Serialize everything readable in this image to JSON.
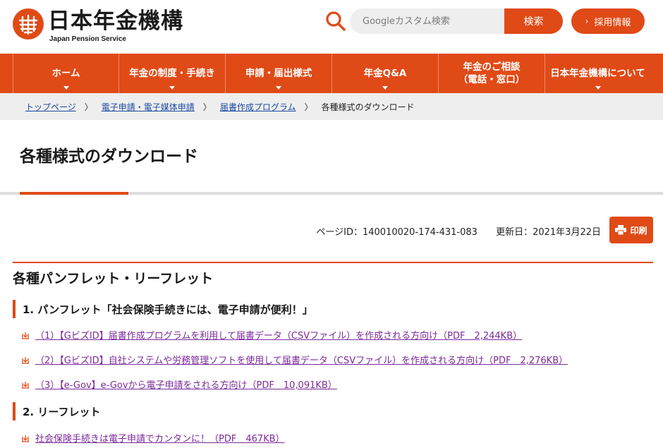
{
  "header": {
    "logo_title": "日本年金機構",
    "logo_subtitle": "Japan Pension Service",
    "search_placeholder": "Googleカスタム検索",
    "search_button": "検索",
    "recruit_button": "採用情報"
  },
  "nav": {
    "items": [
      {
        "label": "ホーム",
        "label2": ""
      },
      {
        "label": "年金の制度・手続き",
        "label2": ""
      },
      {
        "label": "申請・届出様式",
        "label2": ""
      },
      {
        "label": "年金Q&A",
        "label2": ""
      },
      {
        "label": "年金のご相談",
        "label2": "（電話・窓口）"
      },
      {
        "label": "日本年金機構について",
        "label2": ""
      }
    ]
  },
  "breadcrumb": {
    "items": [
      "トップページ",
      "電子申請・電子媒体申請",
      "届書作成プログラム"
    ],
    "current": "各種様式のダウンロード",
    "separator": "〉"
  },
  "page": {
    "title": "各種様式のダウンロード",
    "page_id": "ページID：140010020-174-431-083",
    "updated": "更新日：2021年3月22日",
    "print_label": "印刷"
  },
  "section": {
    "title": "各種パンフレット・リーフレット",
    "groups": [
      {
        "heading": "1.  パンフレット「社会保険手続きには、電子申請が便利！」",
        "links": [
          "（1）【GビズID】届書作成プログラムを利用して届書データ（CSVファイル）を作成される方向け（PDF　2,244KB）",
          "（2）【GビズID】自社システムや労務管理ソフトを使用して届書データ（CSVファイル）を作成される方向け（PDF　2,276KB）",
          "（3）【e-Gov】e-Govから電子申請をされる方向け（PDF　10,091KB）"
        ]
      },
      {
        "heading": "2.  リーフレット",
        "links": [
          "社会保険手続きは電子申請でカンタンに！（PDF　467KB）"
        ]
      }
    ]
  },
  "colors": {
    "brand": "#e04a16",
    "link": "#1a4aa0",
    "visited_link": "#7a2a9a"
  }
}
